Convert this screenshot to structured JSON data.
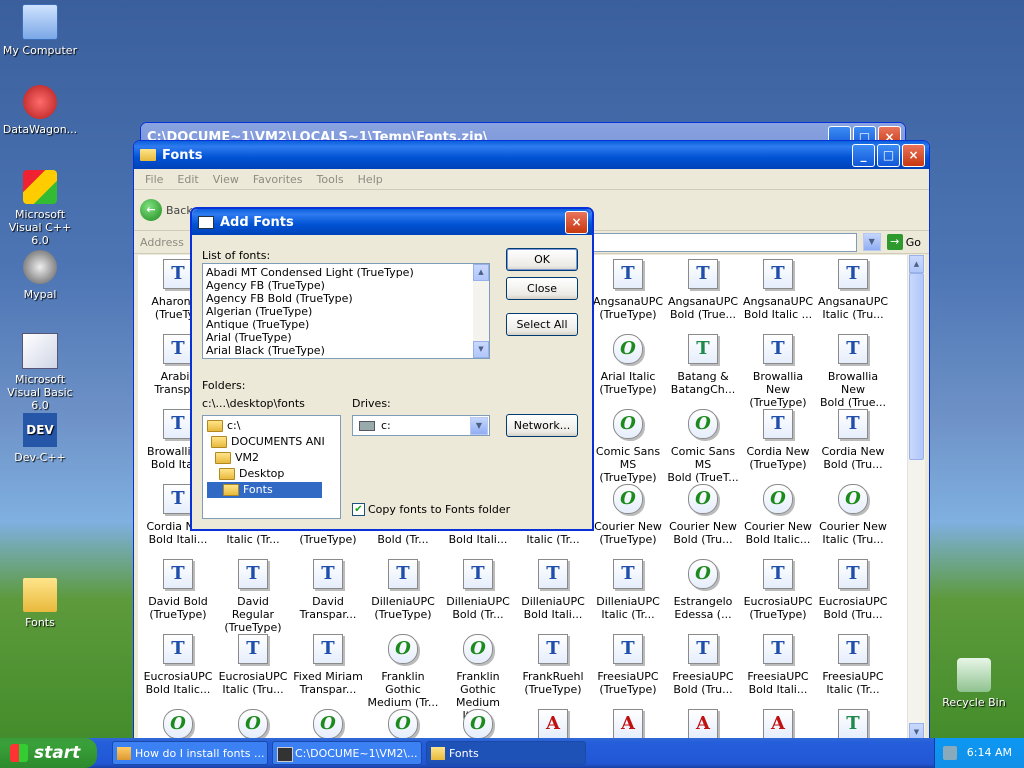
{
  "desktop": {
    "icons": [
      {
        "label": "My Computer"
      },
      {
        "label": "DataWagon..."
      },
      {
        "label": "Microsoft Visual C++ 6.0"
      },
      {
        "label": "Mypal"
      },
      {
        "label": "Microsoft Visual Basic 6.0"
      },
      {
        "label": "Dev-C++"
      },
      {
        "label": "Fonts"
      },
      {
        "label": "Recycle Bin"
      }
    ]
  },
  "bg_window": {
    "title": "C:\\DOCUME~1\\VM2\\LOCALS~1\\Temp\\Fonts.zip\\"
  },
  "fonts_window": {
    "title": "Fonts",
    "menu": [
      "File",
      "Edit",
      "View",
      "Favorites",
      "Tools",
      "Help"
    ],
    "toolbar": {
      "back": "Back"
    },
    "address_label": "Address",
    "go_label": "Go",
    "items": [
      {
        "l1": "Aharoni B",
        "l2": "(TrueTyp",
        "type": "tt"
      },
      {
        "l1": "AngsanaUPC",
        "l2": "(TrueType)",
        "type": "tt"
      },
      {
        "l1": "AngsanaUPC",
        "l2": "Bold (True...",
        "type": "tt"
      },
      {
        "l1": "AngsanaUPC",
        "l2": "Bold Italic ...",
        "type": "tt"
      },
      {
        "l1": "AngsanaUPC",
        "l2": "Italic (Tru...",
        "type": "tt"
      },
      {
        "l1": "Arabic",
        "l2": "Transpar",
        "type": "tt"
      },
      {
        "l1": "Arial Italic",
        "l2": "(TrueType)",
        "type": "ot"
      },
      {
        "l1": "Batang &",
        "l2": "BatangCh...",
        "type": "tg"
      },
      {
        "l1": "Browallia New",
        "l2": "(TrueType)",
        "type": "tt"
      },
      {
        "l1": "Browallia New",
        "l2": "Bold (True...",
        "type": "tt"
      },
      {
        "l1": "Browallia N",
        "l2": "Bold Italic",
        "type": "tt"
      },
      {
        "l1": "Comic Sans MS",
        "l2": "(TrueType)",
        "type": "ot"
      },
      {
        "l1": "Comic Sans MS",
        "l2": "Bold (TrueT...",
        "type": "ot"
      },
      {
        "l1": "Cordia New",
        "l2": "(TrueType)",
        "type": "tt"
      },
      {
        "l1": "Cordia New",
        "l2": "Bold (Tru...",
        "type": "tt"
      },
      {
        "l1": "Cordia New",
        "l2": "Bold Itali...",
        "type": "tt"
      },
      {
        "l1": "Cordia New",
        "l2": "Italic (Tr...",
        "type": "tt"
      },
      {
        "l1": "CordiaUPC",
        "l2": "(TrueType)",
        "type": "tt"
      },
      {
        "l1": "CordiaUPC",
        "l2": "Bold (Tr...",
        "type": "tt"
      },
      {
        "l1": "CordiaUPC",
        "l2": "Bold Itali...",
        "type": "tt"
      },
      {
        "l1": "CordiaUPC",
        "l2": "Italic (Tr...",
        "type": "tt"
      },
      {
        "l1": "Courier New",
        "l2": "(TrueType)",
        "type": "ot"
      },
      {
        "l1": "Courier New",
        "l2": "Bold (Tru...",
        "type": "ot"
      },
      {
        "l1": "Courier New",
        "l2": "Bold Italic...",
        "type": "ot"
      },
      {
        "l1": "Courier New",
        "l2": "Italic (Tru...",
        "type": "ot"
      },
      {
        "l1": "David Bold",
        "l2": "(TrueType)",
        "type": "tt"
      },
      {
        "l1": "David Regular",
        "l2": "(TrueType)",
        "type": "tt"
      },
      {
        "l1": "David",
        "l2": "Transpar...",
        "type": "tt"
      },
      {
        "l1": "DilleniaUPC",
        "l2": "(TrueType)",
        "type": "tt"
      },
      {
        "l1": "DilleniaUPC",
        "l2": "Bold (Tr...",
        "type": "tt"
      },
      {
        "l1": "DilleniaUPC",
        "l2": "Bold Itali...",
        "type": "tt"
      },
      {
        "l1": "DilleniaUPC",
        "l2": "Italic (Tr...",
        "type": "tt"
      },
      {
        "l1": "Estrangelo",
        "l2": "Edessa (...",
        "type": "ot"
      },
      {
        "l1": "EucrosiaUPC",
        "l2": "(TrueType)",
        "type": "tt"
      },
      {
        "l1": "EucrosiaUPC",
        "l2": "Bold (Tru...",
        "type": "tt"
      },
      {
        "l1": "EucrosiaUPC",
        "l2": "Bold Italic...",
        "type": "tt"
      },
      {
        "l1": "EucrosiaUPC",
        "l2": "Italic (Tru...",
        "type": "tt"
      },
      {
        "l1": "Fixed Miriam",
        "l2": "Transpar...",
        "type": "tt"
      },
      {
        "l1": "Franklin Gothic",
        "l2": "Medium (Tr...",
        "type": "ot"
      },
      {
        "l1": "Franklin Gothic",
        "l2": "Medium Itali...",
        "type": "ot"
      },
      {
        "l1": "FrankRuehl",
        "l2": "(TrueType)",
        "type": "tt"
      },
      {
        "l1": "FreesiaUPC",
        "l2": "(TrueType)",
        "type": "tt"
      },
      {
        "l1": "FreesiaUPC",
        "l2": "Bold (Tru...",
        "type": "tt"
      },
      {
        "l1": "FreesiaUPC",
        "l2": "Bold Itali...",
        "type": "tt"
      },
      {
        "l1": "FreesiaUPC",
        "l2": "Italic (Tr...",
        "type": "tt"
      },
      {
        "l1": "",
        "l2": "",
        "type": "ot"
      },
      {
        "l1": "",
        "l2": "",
        "type": "ot"
      },
      {
        "l1": "",
        "l2": "",
        "type": "ot"
      },
      {
        "l1": "",
        "l2": "",
        "type": "ot"
      },
      {
        "l1": "",
        "l2": "",
        "type": "ot"
      },
      {
        "l1": "",
        "l2": "",
        "type": "ps"
      },
      {
        "l1": "",
        "l2": "",
        "type": "ps"
      },
      {
        "l1": "",
        "l2": "",
        "type": "ps"
      },
      {
        "l1": "",
        "l2": "",
        "type": "ps"
      },
      {
        "l1": "",
        "l2": "",
        "type": "tg"
      }
    ]
  },
  "dialog": {
    "title": "Add Fonts",
    "list_label": "List of fonts:",
    "fonts": [
      "Abadi MT Condensed Light (TrueType)",
      "Agency FB (TrueType)",
      "Agency FB Bold (TrueType)",
      "Algerian (TrueType)",
      "Antique (TrueType)",
      "Arial (TrueType)",
      "Arial Black (TrueType)"
    ],
    "ok": "OK",
    "close": "Close",
    "select_all": "Select All",
    "network": "Network...",
    "folders_label": "Folders:",
    "folder_path": "c:\\...\\desktop\\fonts",
    "folders": [
      "c:\\",
      "DOCUMENTS ANI",
      "VM2",
      "Desktop",
      "Fonts"
    ],
    "drives_label": "Drives:",
    "drive_value": "c:",
    "copy_label": "Copy fonts to Fonts folder",
    "copy_checked": true
  },
  "taskbar": {
    "start": "start",
    "tasks": [
      "How do I install fonts ...",
      "C:\\DOCUME~1\\VM2\\...",
      "Fonts"
    ],
    "clock": "6:14 AM"
  }
}
